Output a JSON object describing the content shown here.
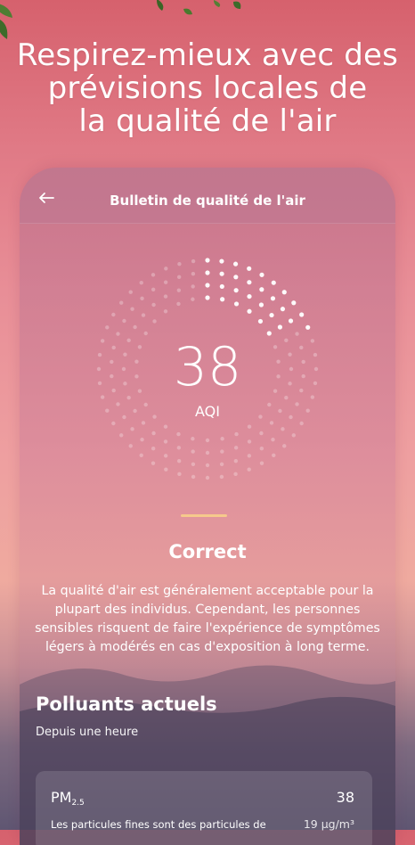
{
  "hero": {
    "title_line1": "Respirez-mieux avec des",
    "title_line2": "prévisions locales de",
    "title_line3": "la qualité de l'air"
  },
  "header": {
    "title": "Bulletin de qualité de l'air",
    "back_icon": "arrow-left-icon"
  },
  "aqi": {
    "value": "38",
    "label": "AQI",
    "status": "Correct",
    "level_fraction": 0.19,
    "accent_color": "#f6c98c"
  },
  "description": "La qualité d'air est généralement acceptable pour la plupart des individus. Cependant, les personnes sensibles risquent de faire l'expérience de symptômes légers à modérés en cas d'exposition à long terme.",
  "pollutants": {
    "title": "Polluants actuels",
    "subtitle": "Depuis une heure",
    "items": [
      {
        "name": "PM",
        "name_sub": "2.5",
        "value": "38",
        "unit": "19 μg/m³",
        "description": "Les particules fines sont des particules de"
      }
    ]
  }
}
